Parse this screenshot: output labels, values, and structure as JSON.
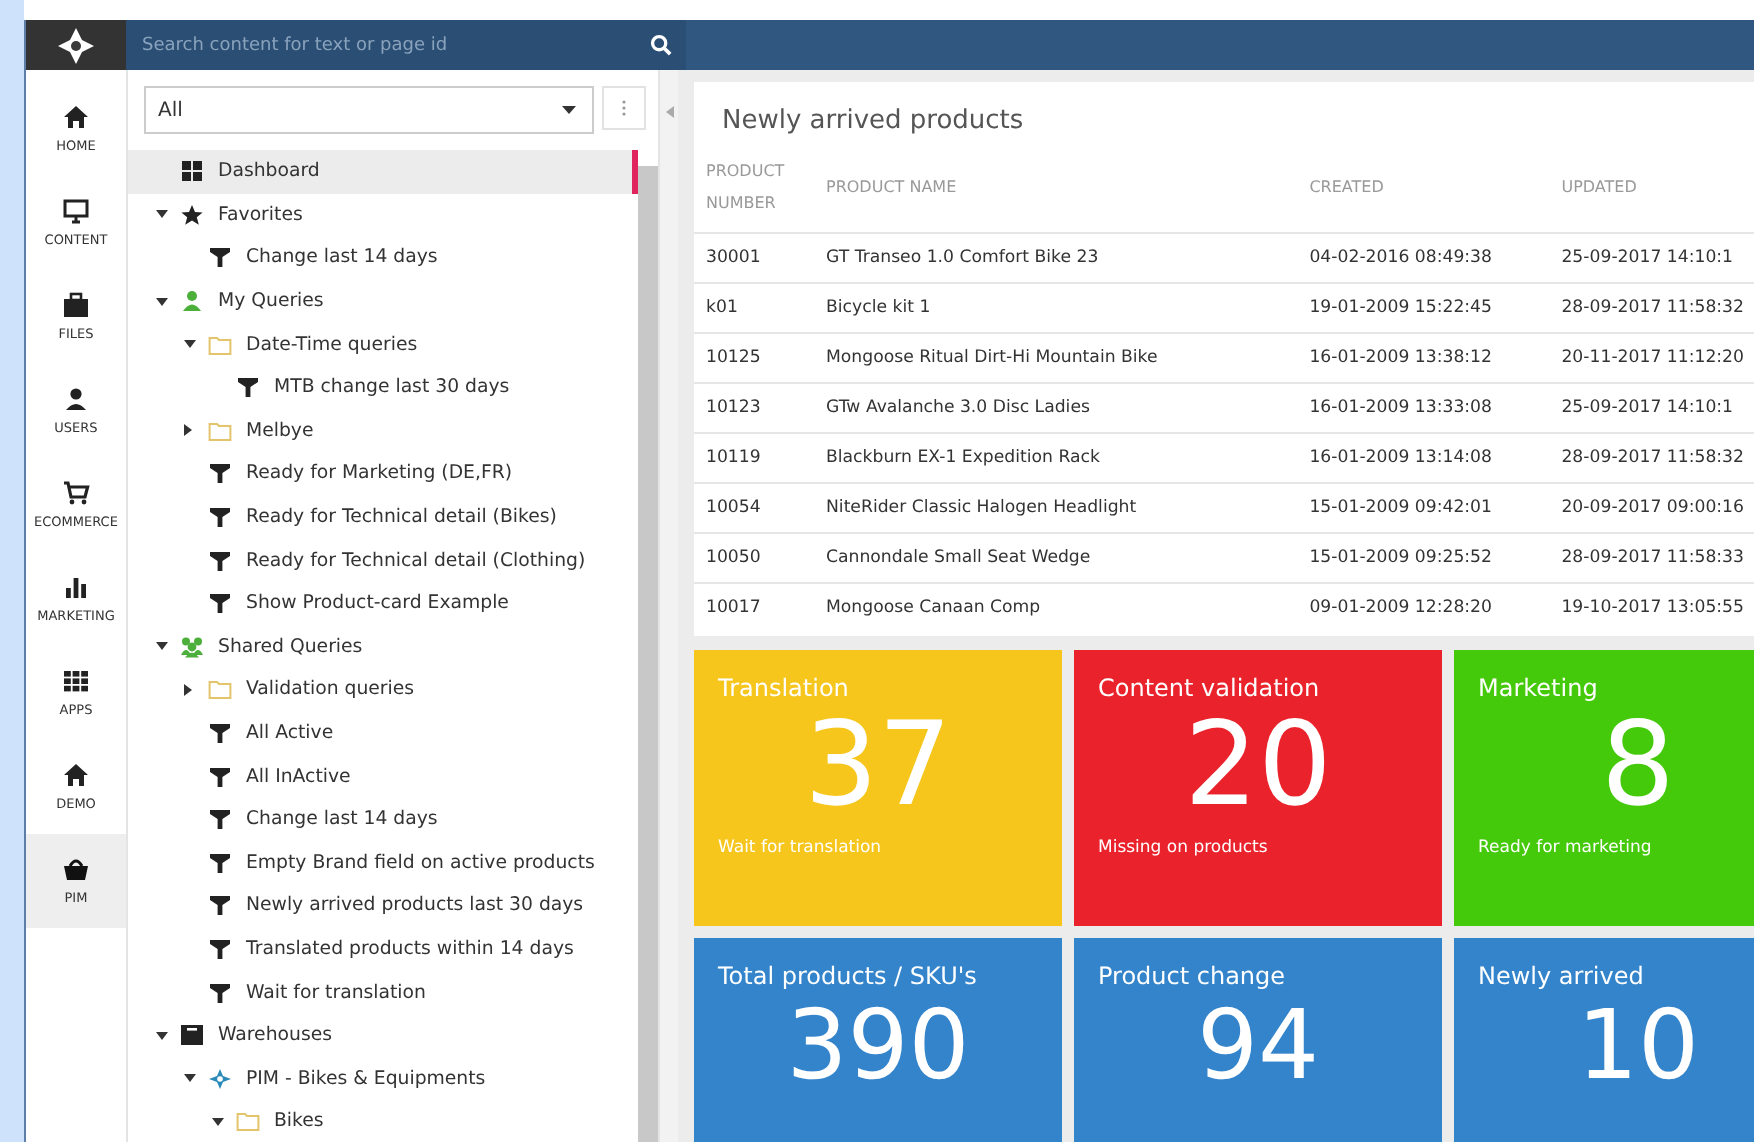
{
  "search": {
    "placeholder": "Search content for text or page id"
  },
  "nav": [
    {
      "label": "HOME",
      "kind": "home",
      "selected": false
    },
    {
      "label": "CONTENT",
      "kind": "content",
      "selected": false
    },
    {
      "label": "FILES",
      "kind": "files",
      "selected": false
    },
    {
      "label": "USERS",
      "kind": "users",
      "selected": false
    },
    {
      "label": "ECOMMERCE",
      "kind": "ecommerce",
      "selected": false
    },
    {
      "label": "MARKETING",
      "kind": "marketing",
      "selected": false
    },
    {
      "label": "APPS",
      "kind": "apps",
      "selected": false
    },
    {
      "label": "DEMO",
      "kind": "demo",
      "selected": false
    },
    {
      "label": "PIM",
      "kind": "pim",
      "selected": true
    }
  ],
  "filter": {
    "value": "All"
  },
  "tree": [
    {
      "label": "Dashboard",
      "kind": "dashboard",
      "selected": true
    },
    {
      "label": "Favorites",
      "kind": "star",
      "selected": false,
      "expanded": true,
      "children": [
        {
          "label": "Change last 14 days",
          "kind": "filter",
          "selected": false
        }
      ]
    },
    {
      "label": "My Queries",
      "kind": "user",
      "selected": false,
      "expanded": true,
      "children": [
        {
          "label": "Date-Time queries",
          "kind": "folder",
          "selected": false,
          "expanded": true,
          "children": [
            {
              "label": "MTB change last 30 days",
              "kind": "filter",
              "selected": false
            }
          ]
        },
        {
          "label": "Melbye",
          "kind": "folder",
          "selected": false,
          "expanded": false
        },
        {
          "label": "Ready for Marketing (DE,FR)",
          "kind": "filter",
          "selected": false
        },
        {
          "label": "Ready for Technical detail (Bikes)",
          "kind": "filter",
          "selected": false
        },
        {
          "label": "Ready for Technical detail (Clothing)",
          "kind": "filter",
          "selected": false
        },
        {
          "label": "Show Product-card Example",
          "kind": "filter",
          "selected": false
        }
      ]
    },
    {
      "label": "Shared Queries",
      "kind": "group",
      "selected": false,
      "expanded": true,
      "children": [
        {
          "label": "Validation queries",
          "kind": "folder",
          "selected": false,
          "expanded": false
        },
        {
          "label": "All Active",
          "kind": "filter",
          "selected": false
        },
        {
          "label": "All InActive",
          "kind": "filter",
          "selected": false
        },
        {
          "label": "Change last 14 days",
          "kind": "filter",
          "selected": false
        },
        {
          "label": "Empty Brand field on active products",
          "kind": "filter",
          "selected": false
        },
        {
          "label": "Newly arrived products last 30 days",
          "kind": "filter",
          "selected": false
        },
        {
          "label": "Translated products within 14 days",
          "kind": "filter",
          "selected": false
        },
        {
          "label": "Wait for translation",
          "kind": "filter",
          "selected": false
        }
      ]
    },
    {
      "label": "Warehouses",
      "kind": "warehouse",
      "selected": false,
      "expanded": true,
      "children": [
        {
          "label": "PIM - Bikes & Equipments",
          "kind": "pim",
          "selected": false,
          "expanded": true,
          "children": [
            {
              "label": "Bikes",
              "kind": "folder",
              "selected": false,
              "expanded": true
            }
          ]
        }
      ]
    }
  ],
  "table": {
    "title": "Newly arrived products",
    "columns": [
      "PRODUCT NUMBER",
      "PRODUCT NAME",
      "CREATED",
      "UPDATED"
    ],
    "rows": [
      [
        "30001",
        "GT Transeo 1.0 Comfort Bike 23",
        "04-02-2016 08:49:38",
        "25-09-2017 14:10:1"
      ],
      [
        "k01",
        "Bicycle kit 1",
        "19-01-2009 15:22:45",
        "28-09-2017 11:58:32"
      ],
      [
        "10125",
        "Mongoose Ritual Dirt-Hi Mountain Bike",
        "16-01-2009 13:38:12",
        "20-11-2017 11:12:20"
      ],
      [
        "10123",
        "GTw Avalanche 3.0 Disc Ladies",
        "16-01-2009 13:33:08",
        "25-09-2017 14:10:1"
      ],
      [
        "10119",
        "Blackburn EX-1 Expedition Rack",
        "16-01-2009 13:14:08",
        "28-09-2017 11:58:32"
      ],
      [
        "10054",
        "NiteRider Classic Halogen Headlight",
        "15-01-2009 09:42:01",
        "20-09-2017 09:00:16"
      ],
      [
        "10050",
        "Cannondale Small Seat Wedge",
        "15-01-2009 09:25:52",
        "28-09-2017 11:58:33"
      ],
      [
        "10017",
        "Mongoose Canaan Comp",
        "09-01-2009 12:28:20",
        "19-10-2017 13:05:55"
      ]
    ]
  },
  "tiles": [
    {
      "title": "Translation",
      "value": "37",
      "caption": "Wait for translation",
      "color": "#f6c61c"
    },
    {
      "title": "Content validation",
      "value": "20",
      "caption": "Missing on products",
      "color": "#ea222b"
    },
    {
      "title": "Marketing",
      "value": "8",
      "caption": "Ready for marketing",
      "color": "#45c90b"
    },
    {
      "title": "Total products / SKU's",
      "value": "390",
      "color": "#3384cb"
    },
    {
      "title": "Product change",
      "value": "94",
      "color": "#3384cb"
    },
    {
      "title": "Newly arrived",
      "value": "10",
      "color": "#3384cb"
    }
  ]
}
